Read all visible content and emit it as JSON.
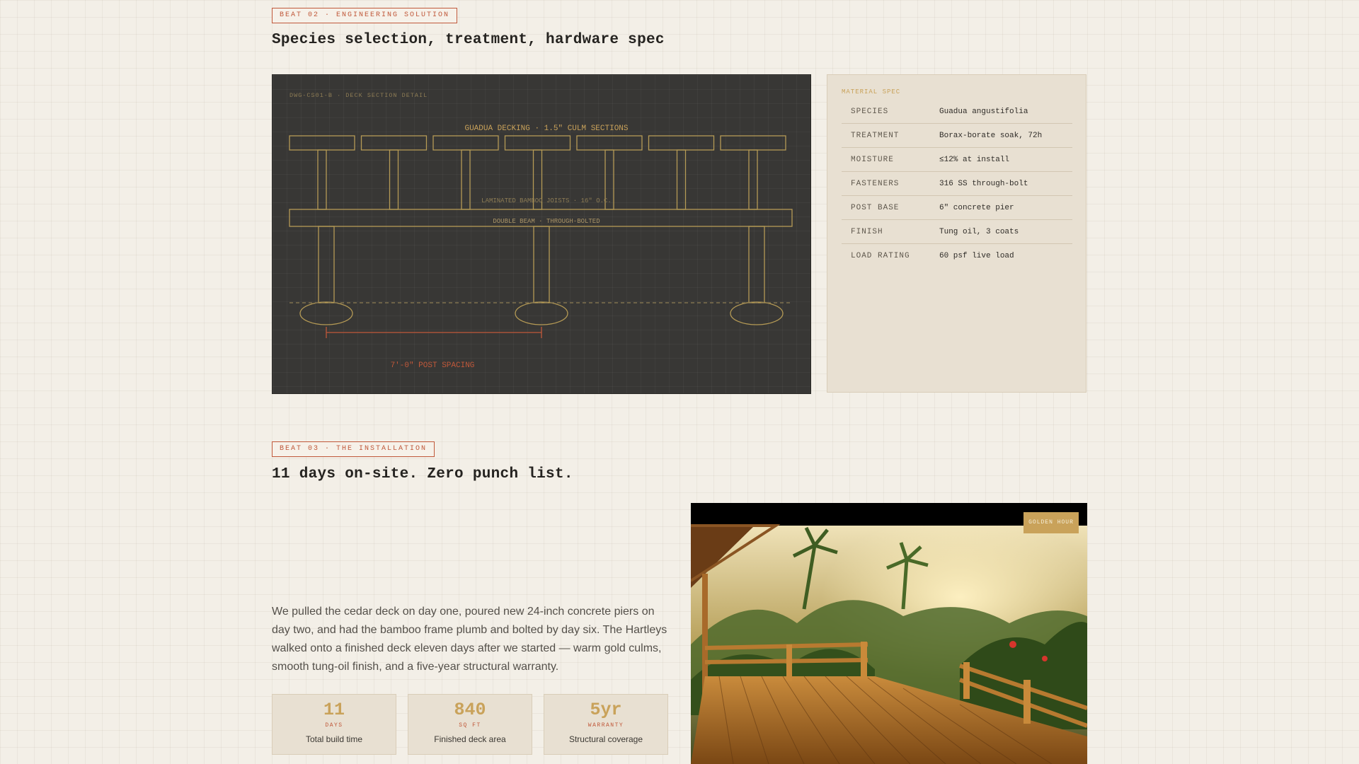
{
  "beat2": {
    "tag": "BEAT 02 · ENGINEERING SOLUTION",
    "heading": "Species selection, treatment, hardware spec"
  },
  "drawing": {
    "ref": "DWG-CS01-B · DECK SECTION DETAIL",
    "decking_label": "GUADUA DECKING · 1.5\" CULM SECTIONS",
    "joists_label": "LAMINATED BAMBOO JOISTS · 16\" O.C.",
    "beam_label": "DOUBLE BEAM · THROUGH-BOLTED",
    "spacing_label": "7'-0\" POST SPACING"
  },
  "spec": {
    "title": "MATERIAL SPEC",
    "rows": [
      {
        "key": "SPECIES",
        "value": "Guadua angustifolia"
      },
      {
        "key": "TREATMENT",
        "value": "Borax-borate soak, 72h"
      },
      {
        "key": "MOISTURE",
        "value": "≤12% at install"
      },
      {
        "key": "FASTENERS",
        "value": "316 SS through-bolt"
      },
      {
        "key": "POST BASE",
        "value": "6\" concrete pier"
      },
      {
        "key": "FINISH",
        "value": "Tung oil, 3 coats"
      },
      {
        "key": "LOAD RATING",
        "value": "60 psf live load"
      }
    ]
  },
  "beat3": {
    "tag": "BEAT 03 · THE INSTALLATION",
    "heading": "11 days on-site. Zero punch list.",
    "paragraph": "We pulled the cedar deck on day one, poured new 24-inch concrete piers on day two, and had the bamboo frame plumb and bolted by day six. The Hartleys walked onto a finished deck eleven days after we started — warm gold culms, smooth tung-oil finish, and a five-year structural warranty."
  },
  "stats": [
    {
      "number": "11",
      "unit": "DAYS",
      "label": "Total build time"
    },
    {
      "number": "840",
      "unit": "SQ FT",
      "label": "Finished deck area"
    },
    {
      "number": "5yr",
      "unit": "WARRANTY",
      "label": "Structural coverage"
    }
  ],
  "photo": {
    "badge": "GOLDEN HOUR"
  },
  "colors": {
    "background": "#f3efe7",
    "accent_red": "#c0583a",
    "accent_gold": "#c9a25a",
    "drawing_bg": "#383735"
  }
}
